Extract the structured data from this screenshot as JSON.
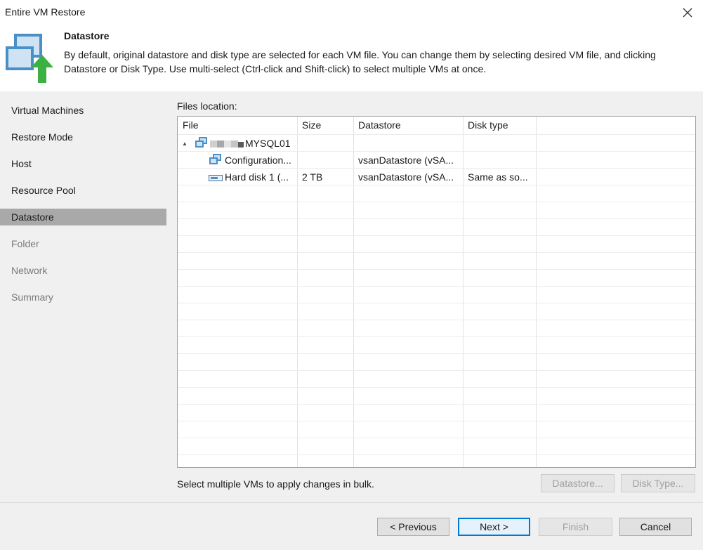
{
  "window": {
    "title": "Entire VM Restore",
    "close_icon": "close-icon"
  },
  "header": {
    "title": "Datastore",
    "description": "By default, original datastore and disk type are selected for each VM file. You can change them by selecting desired VM file, and clicking Datastore or Disk Type. Use multi-select (Ctrl-click and Shift-click) to select multiple VMs at once.",
    "icon": "vm-restore-icon"
  },
  "sidebar": {
    "items": [
      {
        "label": "Virtual Machines",
        "state": "done"
      },
      {
        "label": "Restore Mode",
        "state": "done"
      },
      {
        "label": "Host",
        "state": "done"
      },
      {
        "label": "Resource Pool",
        "state": "done"
      },
      {
        "label": "Datastore",
        "state": "active"
      },
      {
        "label": "Folder",
        "state": "todo"
      },
      {
        "label": "Network",
        "state": "todo"
      },
      {
        "label": "Summary",
        "state": "todo"
      }
    ]
  },
  "main": {
    "files_label": "Files location:",
    "columns": [
      "File",
      "Size",
      "Datastore",
      "Disk type"
    ],
    "rows": [
      {
        "file": "MYSQL01",
        "size": "",
        "datastore": "",
        "disk_type": "",
        "icon": "vm-icon",
        "expander": "▲"
      },
      {
        "file": "Configuration...",
        "size": "",
        "datastore": "vsanDatastore (vSA...",
        "disk_type": "",
        "icon": "config-icon"
      },
      {
        "file": "Hard disk 1 (...",
        "size": "2 TB",
        "datastore": "vsanDatastore (vSA...",
        "disk_type": "Same as so...",
        "icon": "hard-disk-icon"
      }
    ],
    "bulk_note": "Select multiple VMs to apply changes in bulk.",
    "datastore_button": "Datastore...",
    "disk_type_button": "Disk Type..."
  },
  "footer": {
    "previous": "< Previous",
    "next": "Next >",
    "finish": "Finish",
    "cancel": "Cancel"
  },
  "colors": {
    "sidebar_bg": "#f0f0f0",
    "active_bg": "#a9a9a9",
    "accent": "#0078d7",
    "logo_green": "#3cb043",
    "logo_blue": "#4a90c8"
  }
}
